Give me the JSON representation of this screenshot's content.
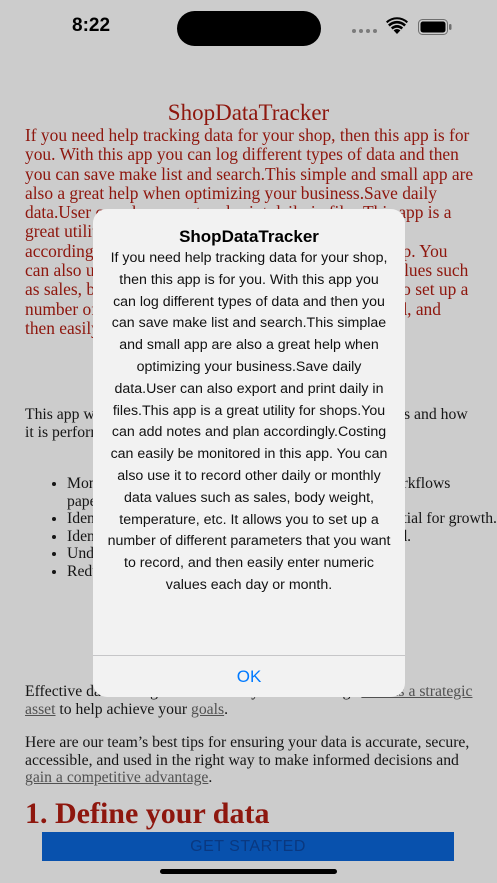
{
  "status_bar": {
    "time": "8:22"
  },
  "page": {
    "title": "ShopDataTracker",
    "intro": "If you need help tracking data for your shop, then this app is for you. With this app you can log different types of data and then you can save make list and search.This simple and small app are also a great help when optimizing your business.Save daily data.User can also export and print daily in files.This app is a great utility for shops.You can add notes and plan accordingly.Costing can easily be monitored in this app. You can also use it to record other daily or monthly data values such as sales, body weight, temperature, etc. It allows you to set up a number of different parameters that you want to record, and then easily enter numeric values each day or month.",
    "paragraph_1": "This app will help you track data to understand your business and how it is performing, and how it can improve over time.",
    "bullets": [
      "Monitor the health of your business decisions and workflows paperwork.",
      "Identify customer behavior and buying patterns essential for growth.",
      "Identify and track areas where improvement is needed.",
      "Understand trends, preferences and habits.",
      "Reduce waste and improve processes."
    ],
    "paragraph_2_text_1": "Effective data management ensures you can leverage ",
    "paragraph_2_link_1": "data as a strategic asset",
    "paragraph_2_text_2": " to help achieve your ",
    "paragraph_2_link_2": "goals",
    "paragraph_2_text_3": ".",
    "paragraph_3_text": "Here are our team’s best tips for ensuring your data is accurate, secure, accessible, and used in the right way to make informed decisions and ",
    "paragraph_3_link": "gain a competitive advantage",
    "paragraph_3_end": ".",
    "section_heading": "1. Define your data",
    "cta_label": "GET STARTED"
  },
  "alert": {
    "title": "ShopDataTracker",
    "message": "If you need help tracking data for your shop, then this app is for you. With this app you can log different types of data and then you can save make list and search.This simplae and small app are also a great help when optimizing your business.Save daily data.User can also export and print daily in files.This app is a great utility for shops.You can add notes and plan accordingly.Costing can easily be monitored in this app. You can also use it to record other daily or monthly data values such as sales, body weight, temperature, etc. It allows you to set up a number of different parameters that you want to record, and then easily enter numeric values each day or month.",
    "ok_label": "OK"
  },
  "colors": {
    "accent_red": "#b21d12",
    "cta_blue": "#0a66d9",
    "ios_blue": "#007aff"
  },
  "icons": [
    "signal-icon",
    "wifi-icon",
    "battery-icon"
  ]
}
